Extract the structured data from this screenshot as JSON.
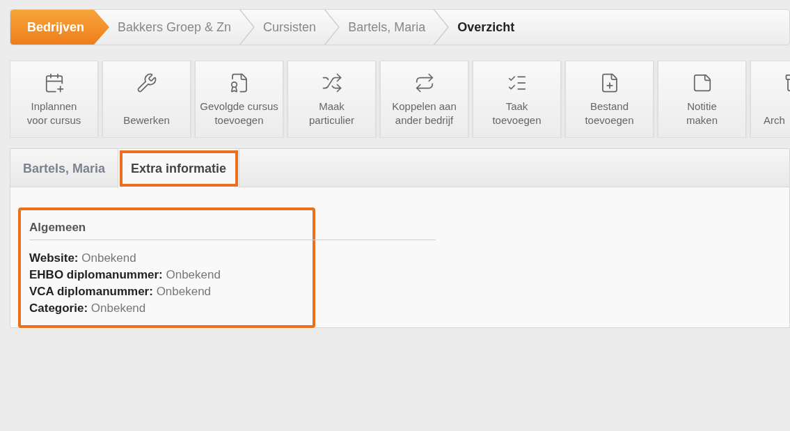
{
  "breadcrumb": [
    {
      "label": "Bedrijven",
      "kind": "root"
    },
    {
      "label": "Bakkers Groep & Zn",
      "kind": "link"
    },
    {
      "label": "Cursisten",
      "kind": "link"
    },
    {
      "label": "Bartels, Maria",
      "kind": "link"
    },
    {
      "label": "Overzicht",
      "kind": "current"
    }
  ],
  "toolbar": [
    {
      "label": "Inplannen\nvoor cursus"
    },
    {
      "label": "Bewerken"
    },
    {
      "label": "Gevolgde cursus\ntoevoegen"
    },
    {
      "label": "Maak\nparticulier"
    },
    {
      "label": "Koppelen aan\nander bedrijf"
    },
    {
      "label": "Taak\ntoevoegen"
    },
    {
      "label": "Bestand\ntoevoegen"
    },
    {
      "label": "Notitie\nmaken"
    },
    {
      "label": "Arch"
    }
  ],
  "tabs": [
    {
      "label": "Bartels, Maria",
      "selected": false,
      "highlighted": false
    },
    {
      "label": "Extra informatie",
      "selected": true,
      "highlighted": true
    }
  ],
  "section": {
    "title": "Algemeen",
    "highlighted": true,
    "fields": [
      {
        "label": "Website:",
        "value": "Onbekend"
      },
      {
        "label": "EHBO diplomanummer:",
        "value": "Onbekend"
      },
      {
        "label": "VCA diplomanummer:",
        "value": "Onbekend"
      },
      {
        "label": "Categorie:",
        "value": "Onbekend"
      }
    ]
  }
}
